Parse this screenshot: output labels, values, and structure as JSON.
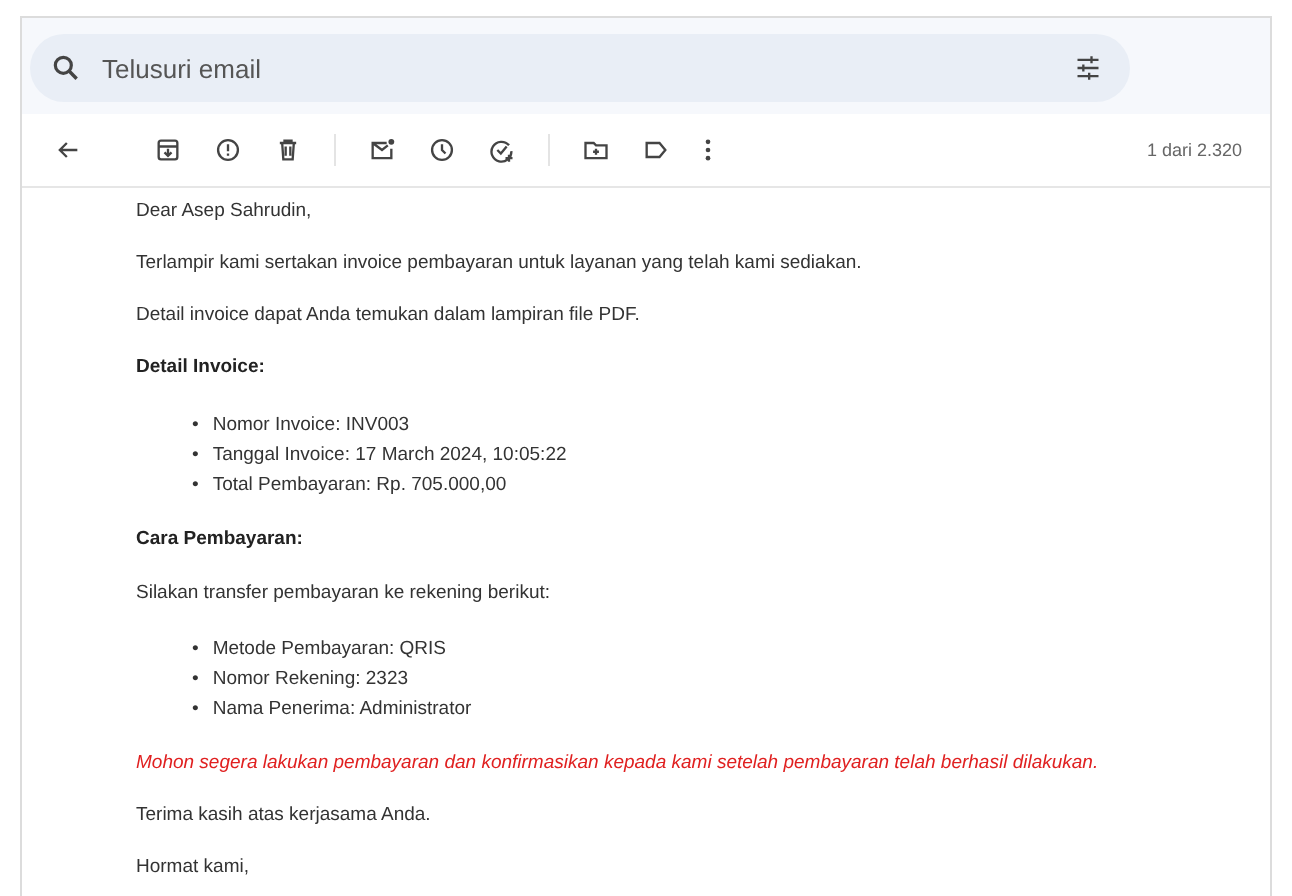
{
  "search": {
    "placeholder": "Telusuri email"
  },
  "toolbar": {
    "counter": "1 dari 2.320"
  },
  "message": [
    {
      "kind": "paragraph",
      "text": "Dear Asep Sahrudin,"
    },
    {
      "kind": "paragraph",
      "text": "Terlampir kami sertakan invoice pembayaran untuk layanan yang telah kami sediakan."
    },
    {
      "kind": "paragraph",
      "text": "Detail invoice dapat Anda temukan dalam lampiran file PDF."
    },
    {
      "kind": "heading",
      "text": "Detail Invoice:"
    },
    {
      "kind": "list",
      "marker": "•",
      "items": [
        "Nomor Invoice: INV003",
        "Tanggal Invoice: 17 March 2024, 10:05:22",
        "Total Pembayaran: Rp. 705.000,00"
      ]
    },
    {
      "kind": "heading",
      "text": "Cara Pembayaran:"
    },
    {
      "kind": "paragraph",
      "text": "Silakan transfer pembayaran ke rekening berikut:"
    },
    {
      "kind": "list",
      "marker": "•",
      "items": [
        "Metode Pembayaran: QRIS",
        "Nomor Rekening: 2323",
        "Nama Penerima: Administrator"
      ]
    },
    {
      "kind": "warning",
      "text": "Mohon segera lakukan pembayaran dan konfirmasikan kepada kami setelah pembayaran telah berhasil dilakukan."
    },
    {
      "kind": "paragraph",
      "text": "Terima kasih atas kerjasama Anda."
    },
    {
      "kind": "paragraph",
      "text": "Hormat kami,"
    }
  ]
}
